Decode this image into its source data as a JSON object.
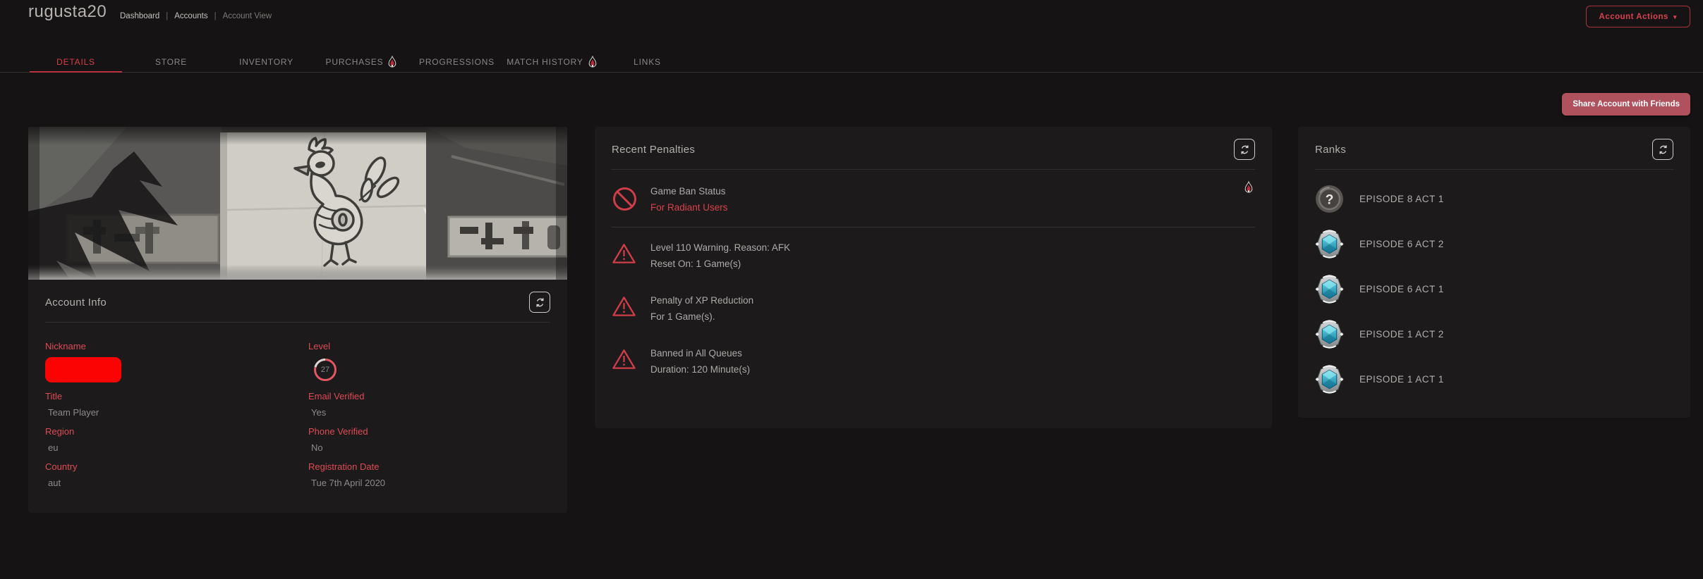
{
  "header": {
    "title": "rugusta20",
    "breadcrumb": [
      "Dashboard",
      "Accounts",
      "Account View"
    ],
    "account_actions_label": "Account Actions",
    "share_button_label": "Share Account with Friends"
  },
  "tabs": [
    {
      "label": "DETAILS",
      "active": true,
      "flame": false
    },
    {
      "label": "STORE",
      "active": false,
      "flame": false
    },
    {
      "label": "INVENTORY",
      "active": false,
      "flame": false
    },
    {
      "label": "PURCHASES",
      "active": false,
      "flame": true
    },
    {
      "label": "PROGRESSIONS",
      "active": false,
      "flame": false
    },
    {
      "label": "MATCH HISTORY",
      "active": false,
      "flame": true
    },
    {
      "label": "LINKS",
      "active": false,
      "flame": false
    }
  ],
  "account_info": {
    "title": "Account Info",
    "refresh_icon": "refresh-icon",
    "banner_icon": "rooster-poster-banner-art",
    "fields_left": [
      {
        "label": "Nickname",
        "value": "",
        "redacted": true
      },
      {
        "label": "Title",
        "value": "Team Player"
      },
      {
        "label": "Region",
        "value": "eu"
      },
      {
        "label": "Country",
        "value": "aut"
      }
    ],
    "fields_right": [
      {
        "label": "Level",
        "value": "27",
        "ring": true
      },
      {
        "label": "Email Verified",
        "value": "Yes"
      },
      {
        "label": "Phone Verified",
        "value": "No"
      },
      {
        "label": "Registration Date",
        "value": "Tue 7th April 2020"
      }
    ]
  },
  "penalties": {
    "title": "Recent Penalties",
    "refresh_icon": "refresh-icon",
    "ban_status": {
      "icon": "no-entry-icon",
      "label": "Game Ban Status",
      "value": "For Radiant Users",
      "right_icon": "flame-icon"
    },
    "items": [
      {
        "icon": "warning-triangle-icon",
        "line1": "Level 110 Warning. Reason: AFK",
        "line2": "Reset On: 1 Game(s)"
      },
      {
        "icon": "warning-triangle-icon",
        "line1": "Penalty of XP Reduction",
        "line2": "For 1 Game(s)."
      },
      {
        "icon": "warning-triangle-icon",
        "line1": "Banned in All Queues",
        "line2": "Duration: 120 Minute(s)"
      }
    ]
  },
  "ranks": {
    "title": "Ranks",
    "refresh_icon": "refresh-icon",
    "unranked_glyph": "?",
    "items": [
      {
        "label": "EPISODE 8 ACT 1",
        "badge": "unranked"
      },
      {
        "label": "EPISODE 6 ACT 2",
        "badge": "teal"
      },
      {
        "label": "EPISODE 6 ACT 1",
        "badge": "teal"
      },
      {
        "label": "EPISODE 1 ACT 2",
        "badge": "teal"
      },
      {
        "label": "EPISODE 1 ACT 1",
        "badge": "teal"
      }
    ]
  },
  "colors": {
    "accent_red": "#d8414e",
    "label_red": "#dd4b56",
    "share_button_bg": "#b0515e",
    "page_bg": "#151313",
    "card_bg": "#1c1a1b",
    "rank_teal": "#3fc2d8",
    "redaction_red": "#fb0303",
    "ring_red": "#e25763"
  }
}
